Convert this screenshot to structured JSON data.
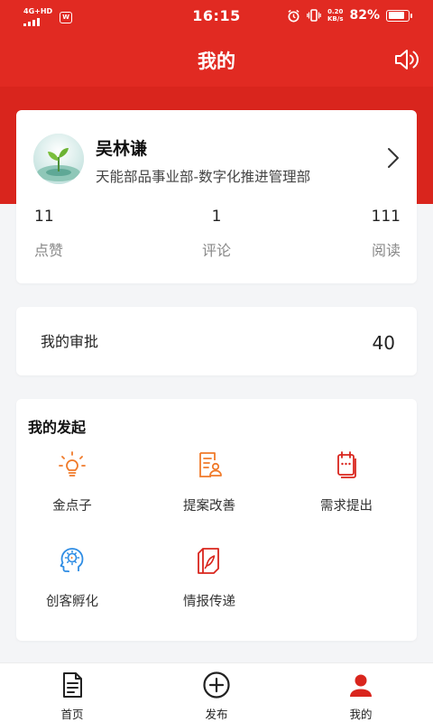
{
  "status_bar": {
    "network": "4G+HD",
    "time": "16:15",
    "speed_value": "0.20",
    "speed_unit": "KB/s",
    "battery": "82%"
  },
  "header": {
    "title": "我的"
  },
  "profile": {
    "name": "吴林谦",
    "department": "天能部品事业部-数字化推进管理部",
    "stats": [
      {
        "value": "11",
        "label": "点赞"
      },
      {
        "value": "1",
        "label": "评论"
      },
      {
        "value": "111",
        "label": "阅读"
      }
    ]
  },
  "approval": {
    "label": "我的审批",
    "count": "40"
  },
  "launch": {
    "title": "我的发起",
    "items": [
      {
        "label": "金点子",
        "icon": "lightbulb-icon"
      },
      {
        "label": "提案改善",
        "icon": "proposal-doc-icon"
      },
      {
        "label": "需求提出",
        "icon": "notepad-icon"
      },
      {
        "label": "创客孵化",
        "icon": "head-idea-icon"
      },
      {
        "label": "情报传递",
        "icon": "feather-doc-icon"
      }
    ]
  },
  "tabbar": {
    "items": [
      {
        "label": "首页",
        "icon": "document-icon"
      },
      {
        "label": "发布",
        "icon": "plus-circle-icon"
      },
      {
        "label": "我的",
        "icon": "person-icon"
      }
    ],
    "active": "我的"
  },
  "colors": {
    "primary_red": "#d9251d",
    "icon_orange": "#f07a2a",
    "icon_blue": "#2f8de4",
    "background": "#f4f5f7"
  }
}
